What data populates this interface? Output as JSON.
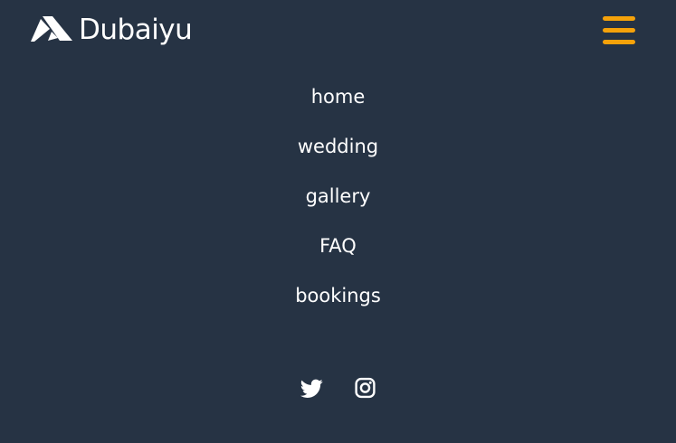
{
  "header": {
    "brand_name": "Dubaiyu",
    "logo_icon": "dubaiyu-logo",
    "menu_icon": "hamburger-menu-icon"
  },
  "nav": {
    "items": [
      {
        "label": "home"
      },
      {
        "label": "wedding"
      },
      {
        "label": "gallery"
      },
      {
        "label": "FAQ"
      },
      {
        "label": "bookings"
      }
    ]
  },
  "social": {
    "icons": [
      "twitter-icon",
      "instagram-icon"
    ]
  },
  "colors": {
    "background": "#263344",
    "accent": "#f5a20a",
    "text": "#ffffff"
  }
}
